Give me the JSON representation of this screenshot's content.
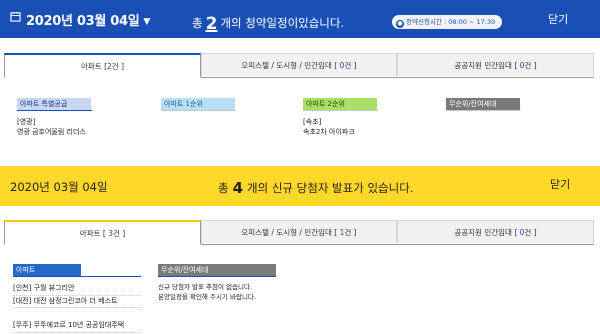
{
  "top": {
    "date": "2020년 03월 04일",
    "message_before": "총",
    "count": "2",
    "message_after": "개의 청약일정이있습니다.",
    "hours_label": "청약신청시간 : 08:00 ~ 17:30",
    "close_label": "닫기",
    "tabs": [
      {
        "label": "아파트 [",
        "count": "2",
        "suffix": "건 ]"
      },
      {
        "label": "오피스텔 / 도시형 / 민간임대 [ ",
        "count": "0",
        "suffix": "건 ]"
      },
      {
        "label": "공공지원 민간임대 [ ",
        "count": "0",
        "suffix": "건 ]"
      }
    ],
    "categories": [
      {
        "tag": "아파트 특별공급",
        "items": [
          "[영광]",
          "영광 금호어울림 리더스"
        ]
      },
      {
        "tag": "아파트 1순위",
        "items": []
      },
      {
        "tag": "아파트 2순위",
        "items": [
          "[속초]",
          "속초2차 아이파크"
        ]
      },
      {
        "tag": "무순위/잔여세대",
        "items": []
      }
    ]
  },
  "bottom": {
    "date": "2020년 03월 04일",
    "message_before": "총",
    "count": "4",
    "message_after": "개의 신규 당첨자 발표가 있습니다.",
    "close_label": "닫기",
    "tabs": [
      {
        "label": "아파트 [ ",
        "count": "3",
        "suffix": "건 ]"
      },
      {
        "label": "오피스텔 / 도시형 / 민간임대 [ ",
        "count": "1",
        "suffix": "건 ]"
      },
      {
        "label": "공공지원 민간임대 [ ",
        "count": "0",
        "suffix": "건 ]"
      }
    ],
    "apt_tag": "아파트",
    "apt_items": [
      "[인천]  구월 뷰그리안",
      "[대전]  대전 삼정그린코아 더 베스트",
      "[무주]  무주에코르 10년 공공임대주택"
    ],
    "unranked_tag": "무순위/잔여세대",
    "unranked_notes": [
      "신규 당첨자 발표 추첨이 없습니다.",
      "분양일정을 확인해 주시기 바랍니다."
    ]
  },
  "colors": {
    "primary_blue": "#1a4fb6",
    "yellow": "#ffd82a"
  }
}
